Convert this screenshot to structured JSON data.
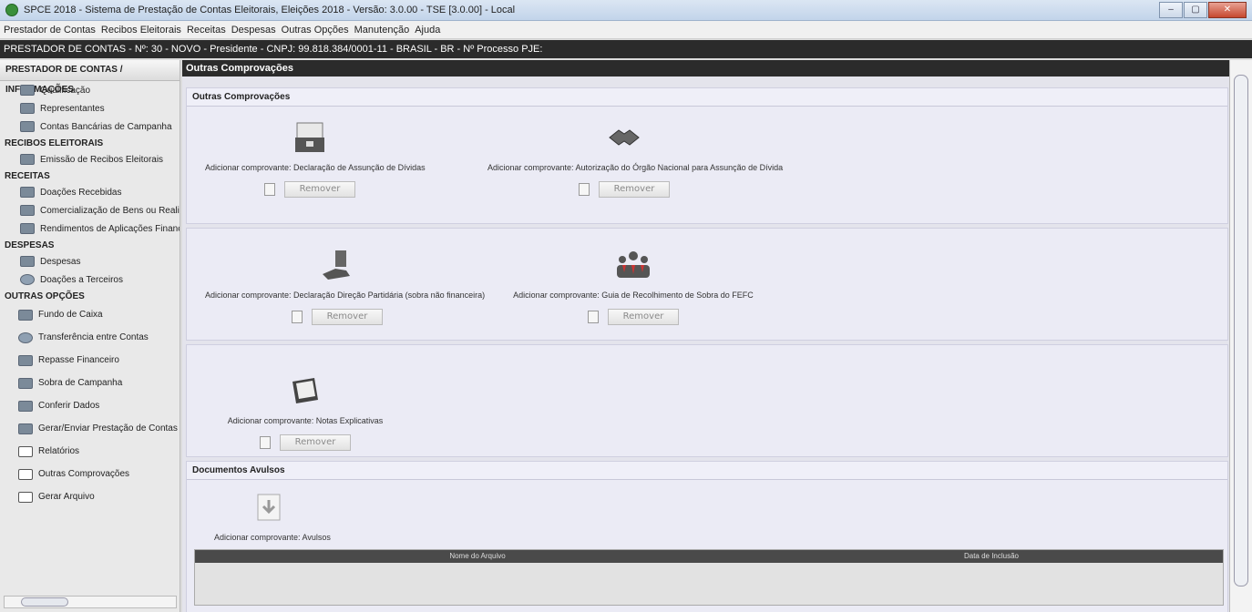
{
  "window": {
    "title": "SPCE 2018 - Sistema de Prestação de Contas Eleitorais, Eleições 2018 - Versão: 3.0.00  -  TSE [3.0.00] - Local"
  },
  "menu": [
    "Prestador de Contas",
    "Recibos Eleitorais",
    "Receitas",
    "Despesas",
    "Outras Opções",
    "Manutenção",
    "Ajuda"
  ],
  "infobar": "PRESTADOR DE CONTAS - Nº: 30 - NOVO - Presidente - CNPJ: 99.818.384/0001-11 - BRASIL - BR - Nº Processo PJE:",
  "sidebar": {
    "header": "PRESTADOR DE CONTAS / INFORMAÇÕES",
    "sections": {
      "prestador": [
        "Qualificação",
        "Representantes",
        "Contas Bancárias de Campanha"
      ],
      "recibos_title": "RECIBOS ELEITORAIS",
      "recibos": [
        "Emissão de Recibos Eleitorais"
      ],
      "receitas_title": "RECEITAS",
      "receitas": [
        "Doações Recebidas",
        "Comercialização de Bens ou Realização d",
        "Rendimentos de Aplicações Financeiras"
      ],
      "despesas_title": "DESPESAS",
      "despesas": [
        "Despesas",
        "Doações a Terceiros"
      ],
      "outras_title": "OUTRAS OPÇÕES",
      "outras": [
        "Fundo de Caixa",
        "Transferência entre Contas",
        "Repasse Financeiro",
        "Sobra de Campanha",
        "Conferir Dados",
        "Gerar/Enviar Prestação de Contas",
        "Relatórios",
        "Outras Comprovações",
        "Gerar Arquivo"
      ]
    }
  },
  "main": {
    "header": "Outras Comprovações",
    "panel1_title": "Outras Comprovações",
    "remove_label": "Remover",
    "cards": [
      "Adicionar comprovante: Declaração de Assunção de Dívidas",
      "Adicionar comprovante: Autorização do Órgão Nacional para Assunção de Dívida",
      "Adicionar comprovante: Declaração Direção Partidária (sobra não financeira)",
      "Adicionar comprovante: Guia de Recolhimento de Sobra do FEFC",
      "Adicionar comprovante: Notas Explicativas"
    ],
    "docs_title": "Documentos Avulsos",
    "avulsos_label": "Adicionar comprovante: Avulsos",
    "table_headers": [
      "Nome do Arquivo",
      "Data de Inclusão"
    ]
  }
}
